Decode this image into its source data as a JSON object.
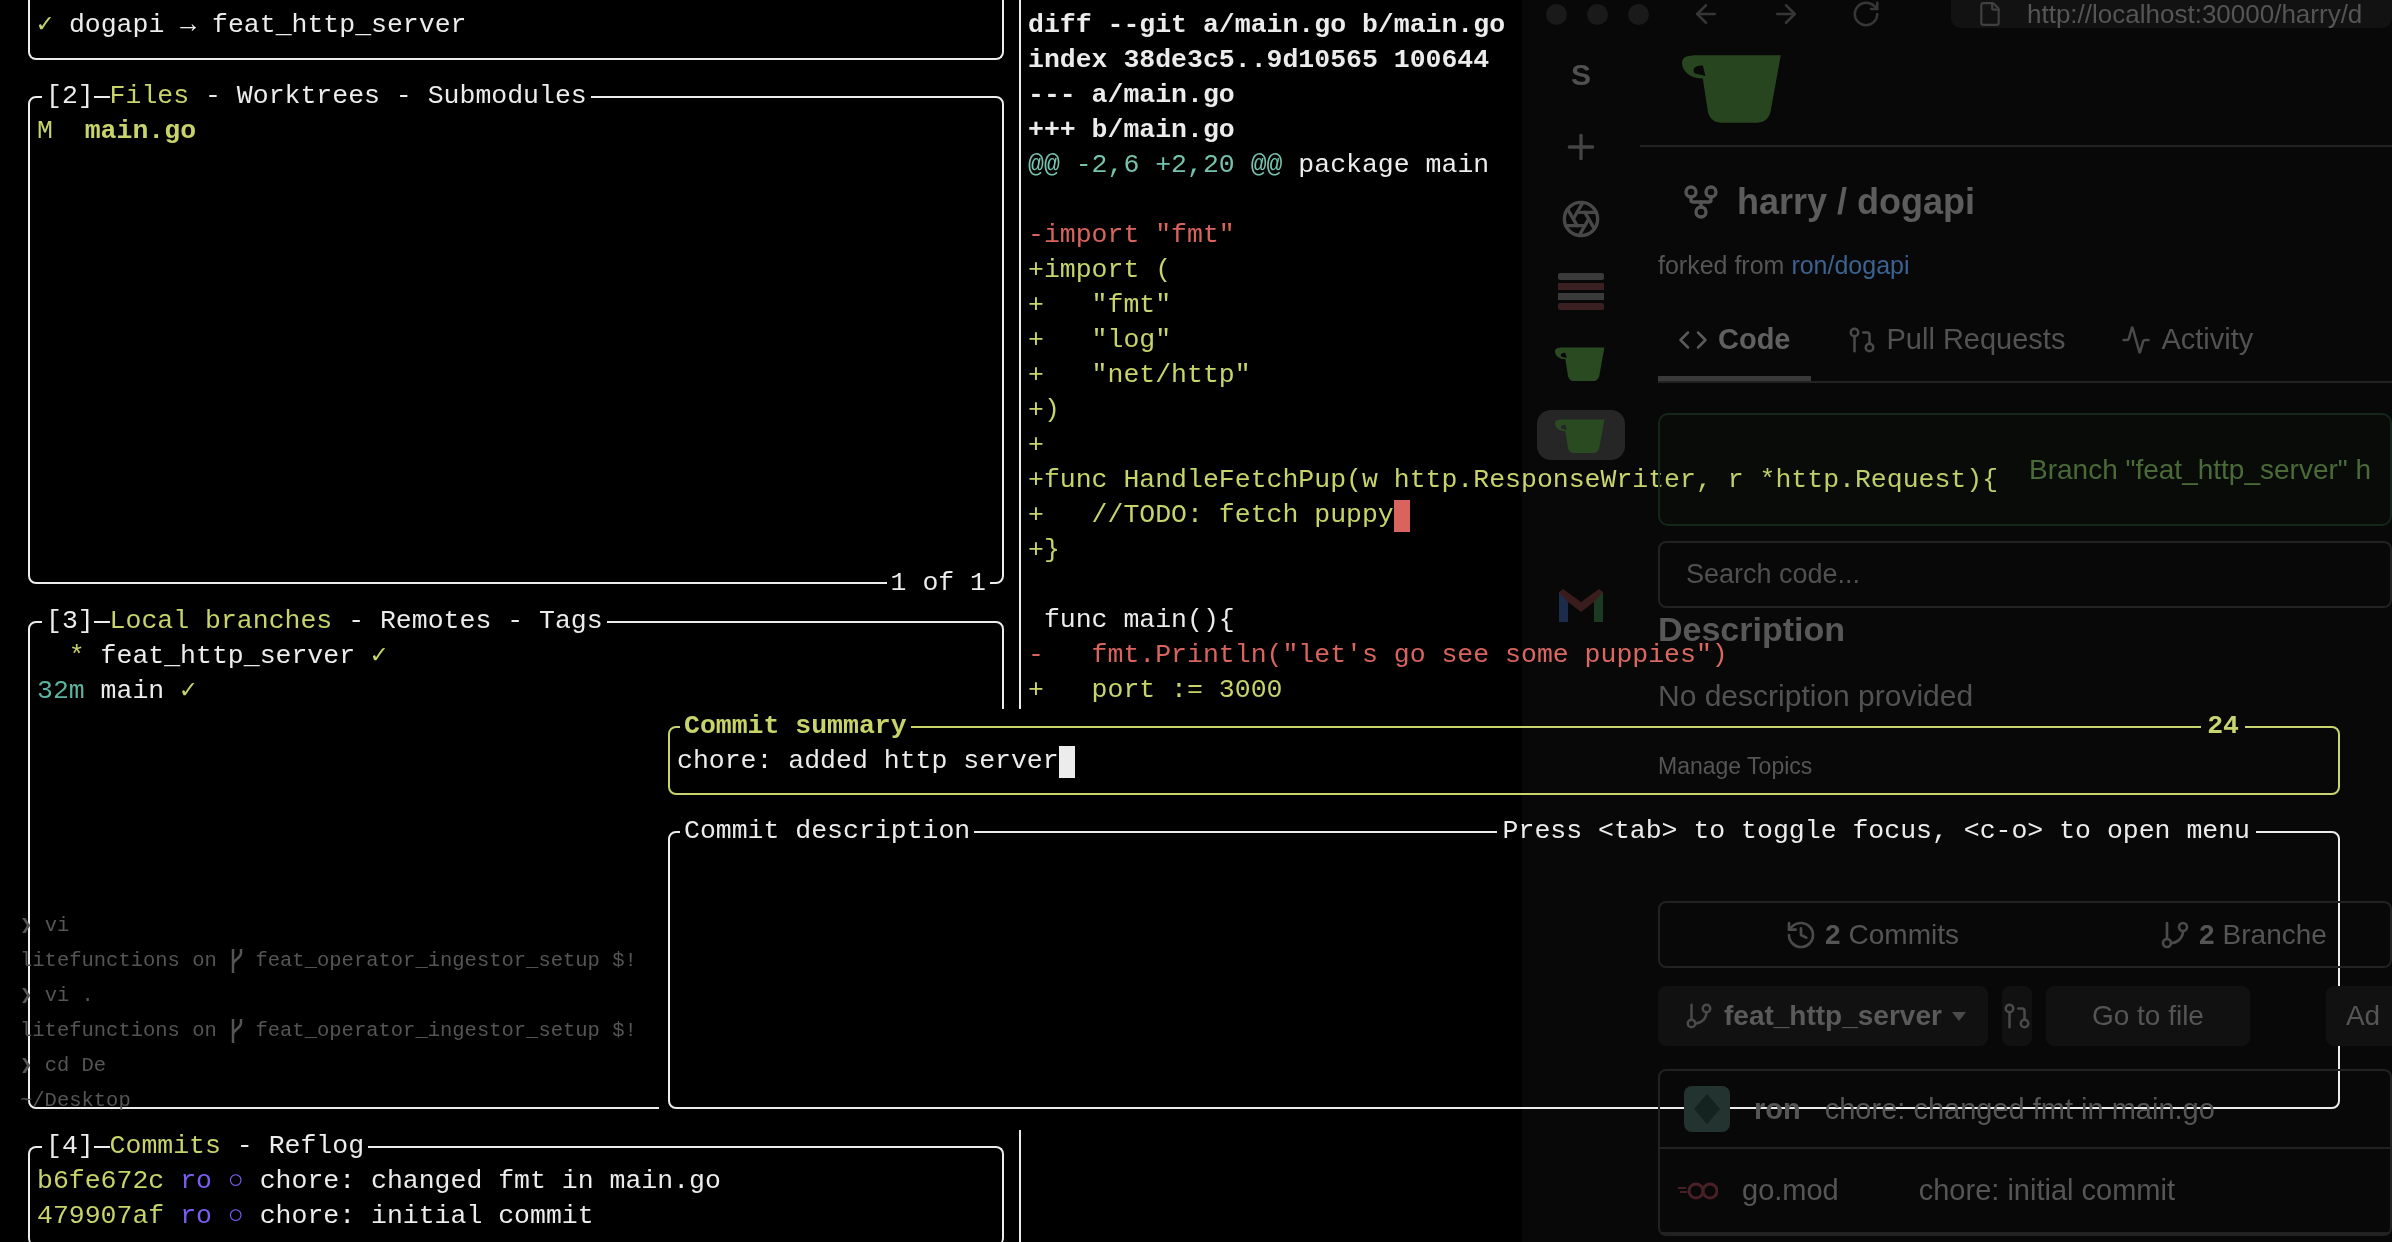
{
  "status": {
    "check": "✓",
    "repo": "dogapi",
    "arrow": "→",
    "branch": "feat_http_server"
  },
  "files_panel": {
    "number": "[2]",
    "separator": "-",
    "tabs": [
      {
        "label": "Files",
        "selected": true
      },
      {
        "label": "Worktrees",
        "selected": false
      },
      {
        "label": "Submodules",
        "selected": false
      }
    ],
    "rows": [
      {
        "status": "M",
        "name": "main.go"
      }
    ],
    "footer": "1 of 1"
  },
  "branches_panel": {
    "number": "[3]",
    "separator": "-",
    "tabs": [
      {
        "label": "Local branches",
        "selected": true
      },
      {
        "label": "Remotes",
        "selected": false
      },
      {
        "label": "Tags",
        "selected": false
      }
    ],
    "rows": [
      {
        "marker": "*",
        "name": "feat_http_server",
        "check": "✓"
      },
      {
        "age": "32m",
        "name": "main",
        "check": "✓"
      }
    ]
  },
  "commits_panel": {
    "number": "[4]",
    "separator": "-",
    "tabs": [
      {
        "label": "Commits",
        "selected": true
      },
      {
        "label": "Reflog",
        "selected": false
      }
    ],
    "rows": [
      {
        "hash": "b6fe672c",
        "author": "ro",
        "graph": "○",
        "message": "chore: changed fmt in main.go"
      },
      {
        "hash": "479907af",
        "author": "ro",
        "graph": "○",
        "message": "chore: initial commit"
      }
    ]
  },
  "diff": {
    "lines": [
      {
        "kind": "meta",
        "text": "diff --git a/main.go b/main.go",
        "cursor": false
      },
      {
        "kind": "meta",
        "text": "index 38de3c5..9d10565 100644",
        "cursor": false
      },
      {
        "kind": "meta",
        "text": "--- a/main.go",
        "cursor": false
      },
      {
        "kind": "meta",
        "text": "+++ b/main.go",
        "cursor": false
      },
      {
        "kind": "hunk",
        "range": "@@ -2,6 +2,20 @@",
        "text": "package main",
        "cursor": false
      },
      {
        "kind": "blank",
        "cursor": false
      },
      {
        "kind": "removed",
        "text": "-import \"fmt\"",
        "cursor": false
      },
      {
        "kind": "added",
        "text": "+import (",
        "cursor": false
      },
      {
        "kind": "added",
        "text": "+   \"fmt\"",
        "cursor": false
      },
      {
        "kind": "added",
        "text": "+   \"log\"",
        "cursor": false
      },
      {
        "kind": "added",
        "text": "+   \"net/http\"",
        "cursor": false
      },
      {
        "kind": "added",
        "text": "+)",
        "cursor": false
      },
      {
        "kind": "added",
        "text": "+",
        "cursor": false
      },
      {
        "kind": "added",
        "text": "+func HandleFetchPup(w http.ResponseWriter, r *http.Request){",
        "cursor": false
      },
      {
        "kind": "added",
        "text": "+   //TODO: fetch puppy",
        "cursor": true
      },
      {
        "kind": "added",
        "text": "+}",
        "cursor": false
      },
      {
        "kind": "blank",
        "cursor": false
      },
      {
        "kind": "context",
        "text": " func main(){",
        "cursor": false
      },
      {
        "kind": "removed",
        "text": "-   fmt.Println(\"let's go see some puppies\")",
        "cursor": false
      },
      {
        "kind": "added",
        "text": "+   port := 3000",
        "cursor": false
      }
    ]
  },
  "commit_dialog": {
    "summary": {
      "title": "Commit summary",
      "counter": "24",
      "value": "chore: added http server",
      "cursor": true,
      "focused": true
    },
    "description": {
      "title": "Commit description",
      "hint": "Press <tab> to toggle focus, <c-o> to open menu",
      "focused": false
    }
  },
  "background_shell": {
    "lines": [
      {
        "kind": "prompt",
        "symbol": "❯",
        "command": "vi"
      },
      {
        "kind": "location",
        "text": "litefunctions on",
        "branch": "feat_operator_ingestor_setup $!"
      },
      {
        "kind": "prompt",
        "symbol": "❯",
        "command": "vi ."
      },
      {
        "kind": "location",
        "text": "litefunctions on",
        "branch": "feat_operator_ingestor_setup $!"
      },
      {
        "kind": "prompt",
        "symbol": "❯",
        "command": "cd De"
      },
      {
        "kind": "cwd",
        "text": "~/Desktop"
      }
    ]
  },
  "browser": {
    "url": "http://localhost:30000/harry/d",
    "sidebar": [
      {
        "kind": "letter",
        "text": "S",
        "selected": false
      },
      {
        "kind": "plus",
        "selected": false
      },
      {
        "kind": "aperture",
        "selected": false
      },
      {
        "kind": "stack",
        "selected": false
      },
      {
        "kind": "cup",
        "selected": false
      },
      {
        "kind": "cup",
        "selected": true
      },
      {
        "kind": "mail",
        "selected": false
      }
    ],
    "repo_title": "harry / dogapi",
    "forked_label": "forked from",
    "forked_link": "ron/dogapi",
    "tabs": [
      {
        "kind": "code",
        "label": "Code",
        "selected": true
      },
      {
        "kind": "pull",
        "label": "Pull Requests",
        "selected": false
      },
      {
        "kind": "pulse",
        "label": "Activity",
        "selected": false
      }
    ],
    "banner": "Branch \"feat_http_server\" h",
    "search_placeholder": "Search code...",
    "description_heading": "Description",
    "description_text": "No description provided",
    "topics_link": "Manage Topics",
    "stats": [
      {
        "kind": "history",
        "count": "2",
        "label": "Commits"
      },
      {
        "kind": "branch",
        "count": "2",
        "label": "Branche"
      }
    ],
    "branch_selector": "feat_http_server",
    "go_to_file": "Go to file",
    "add_button": "Ad",
    "commits": [
      {
        "kind": "commit",
        "author": "ron",
        "message": "chore: changed fmt in main.go"
      },
      {
        "kind": "file",
        "name": "go.mod",
        "message": "chore: initial commit"
      }
    ]
  }
}
